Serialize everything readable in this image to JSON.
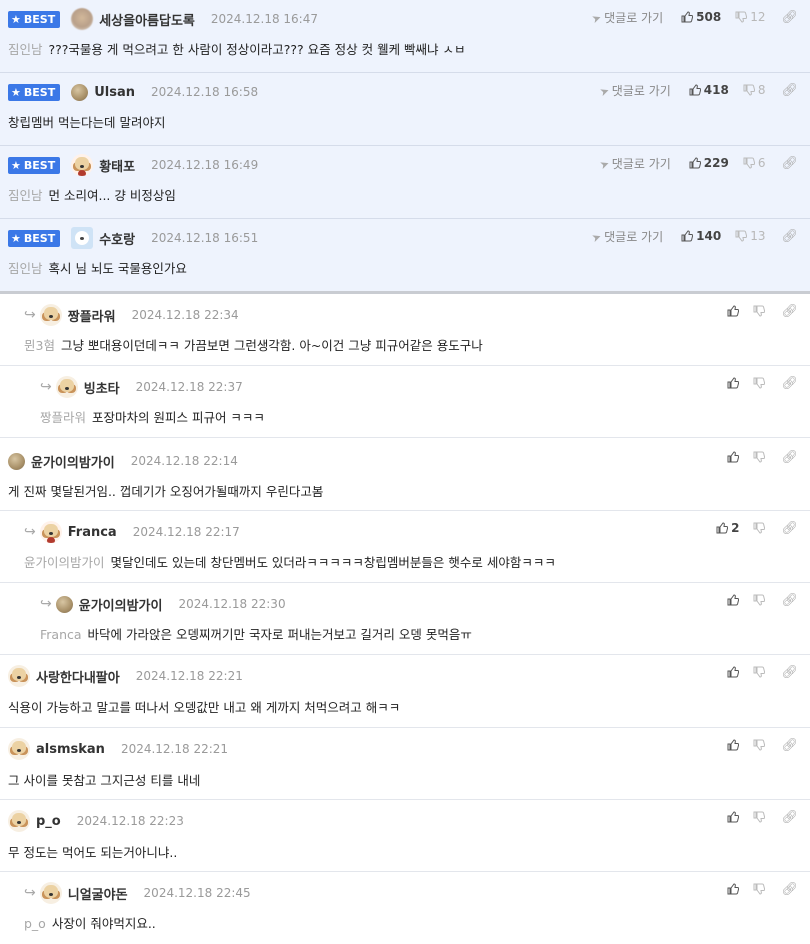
{
  "labels": {
    "best": "BEST",
    "go_reply": "댓글로 가기"
  },
  "best_comments": [
    {
      "nick": "세상을아름답도록",
      "date": "2024.12.18 16:47",
      "text": "???국물용 게 먹으려고 한 사람이 정상이라고??? 요즘 정상 컷 웰케 빡쌔냐 ㅅㅂ",
      "to": "짐인남",
      "up": "508",
      "down": "12",
      "avatar": "blurred-avatar"
    },
    {
      "nick": "Ulsan",
      "date": "2024.12.18 16:58",
      "text": "창립멤버 먹는다는데 말려야지",
      "to": "",
      "up": "418",
      "down": "8",
      "avatar": "ball-avatar"
    },
    {
      "nick": "황태포",
      "date": "2024.12.18 16:49",
      "text": "먼 소리여... 걍 비정상임",
      "to": "짐인남",
      "up": "229",
      "down": "6",
      "avatar": "dog-avatar"
    },
    {
      "nick": "수호랑",
      "date": "2024.12.18 16:51",
      "text": "혹시 님 뇌도 국물용인가요",
      "to": "짐인남",
      "up": "140",
      "down": "13",
      "avatar": "bear-avatar"
    }
  ],
  "comments": [
    {
      "nick": "짱플라워",
      "date": "2024.12.18 22:34",
      "to": "뮌3혐",
      "text": "그냥 뽀대용이던데ㅋㅋ 가끔보면 그런생각함. 아~이건 그냥 피규어같은 용도구나",
      "up": ""
    },
    {
      "nick": "빙초타",
      "date": "2024.12.18 22:37",
      "to": "짱플라워",
      "text": "포장마차의 원피스 피규어 ㅋㅋㅋ",
      "up": ""
    },
    {
      "nick": "윤가이의밤가이",
      "date": "2024.12.18 22:14",
      "to": "",
      "text": "게 진짜 몇달된거임.. 껍데기가 오징어가될때까지 우린다고봄",
      "up": ""
    },
    {
      "nick": "Franca",
      "date": "2024.12.18 22:17",
      "to": "윤가이의밤가이",
      "text": "몇달인데도 있는데 창단멤버도 있더라ㅋㅋㅋㅋㅋ창립멤버분들은 햇수로 세야함ㅋㅋㅋ",
      "up": "2"
    },
    {
      "nick": "윤가이의밤가이",
      "date": "2024.12.18 22:30",
      "to": "Franca",
      "text": "바닥에 가라앉은 오뎅찌꺼기만 국자로 퍼내는거보고 길거리 오뎅 못먹음ㅠ",
      "up": ""
    },
    {
      "nick": "사랑한다내팔아",
      "date": "2024.12.18 22:21",
      "to": "",
      "text": "식용이 가능하고 말고를 떠나서 오뎅값만 내고 왜 게까지 처먹으려고 해ㅋㅋ",
      "up": ""
    },
    {
      "nick": "alsmskan",
      "date": "2024.12.18 22:21",
      "to": "",
      "text": "그 사이를 못참고 그지근성 티를 내네",
      "up": ""
    },
    {
      "nick": "p_o",
      "date": "2024.12.18 22:23",
      "to": "",
      "text": "무 정도는 먹어도 되는거아니냐..",
      "up": ""
    },
    {
      "nick": "니얼굴야돈",
      "date": "2024.12.18 22:45",
      "to": "p_o",
      "text": "사장이 줘야먹지요..",
      "up": ""
    }
  ]
}
